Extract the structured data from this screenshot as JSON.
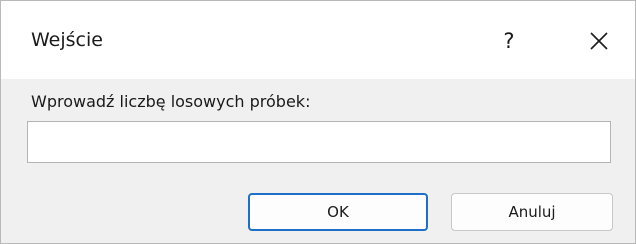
{
  "dialog": {
    "title": "Wejście",
    "help_label": "?",
    "prompt": "Wprowadź liczbę losowych próbek:",
    "input": {
      "value": "",
      "placeholder": ""
    },
    "buttons": {
      "ok": "OK",
      "cancel": "Anuluj"
    }
  },
  "icons": {
    "close": "close-icon"
  },
  "colors": {
    "dialog_background": "#f0f0f0",
    "titlebar_background": "#ffffff",
    "default_button_border": "#1e6fc8"
  }
}
